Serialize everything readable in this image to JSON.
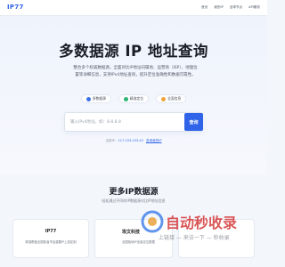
{
  "nav": {
    "logo": "IP77",
    "links": [
      "首页",
      "我的IP",
      "全球节点",
      "API服务"
    ]
  },
  "hero": {
    "title": "多数据源 IP 地址查询",
    "description": "整合多个权威数据源，全面对比IP地址归属地、运营商（ISP）、地理位置等详细信息，支持IPv4地址查询，提升定位准确性和数据可靠性。",
    "features": [
      "多数据源",
      "精准定位",
      "全面信息"
    ]
  },
  "search": {
    "placeholder": "输入IPv4地址，如：8.8.8.8",
    "button_label": "查询"
  },
  "myip": {
    "label": "当前IP：",
    "value": "117.153.153.42",
    "link": "查询我的IP"
  },
  "sources": {
    "title": "更多IP数据源",
    "subtitle": "轻松通过不同的IP数据源对比IP地址信息",
    "cards": [
      {
        "name": "IP77",
        "desc": "精准覆盖全国各省市及重要IP上游定制"
      },
      {
        "name": "埃文科技",
        "desc": "全国各地IP全景定位数据"
      },
      {
        "name": "",
        "desc": ""
      }
    ]
  },
  "watermark": {
    "title": "自动秒收录",
    "subtitle": "上链接 — 来访一下 — 秒收录"
  },
  "colors": {
    "accent": "#2f63e8",
    "watermark": "#d43a3a"
  }
}
